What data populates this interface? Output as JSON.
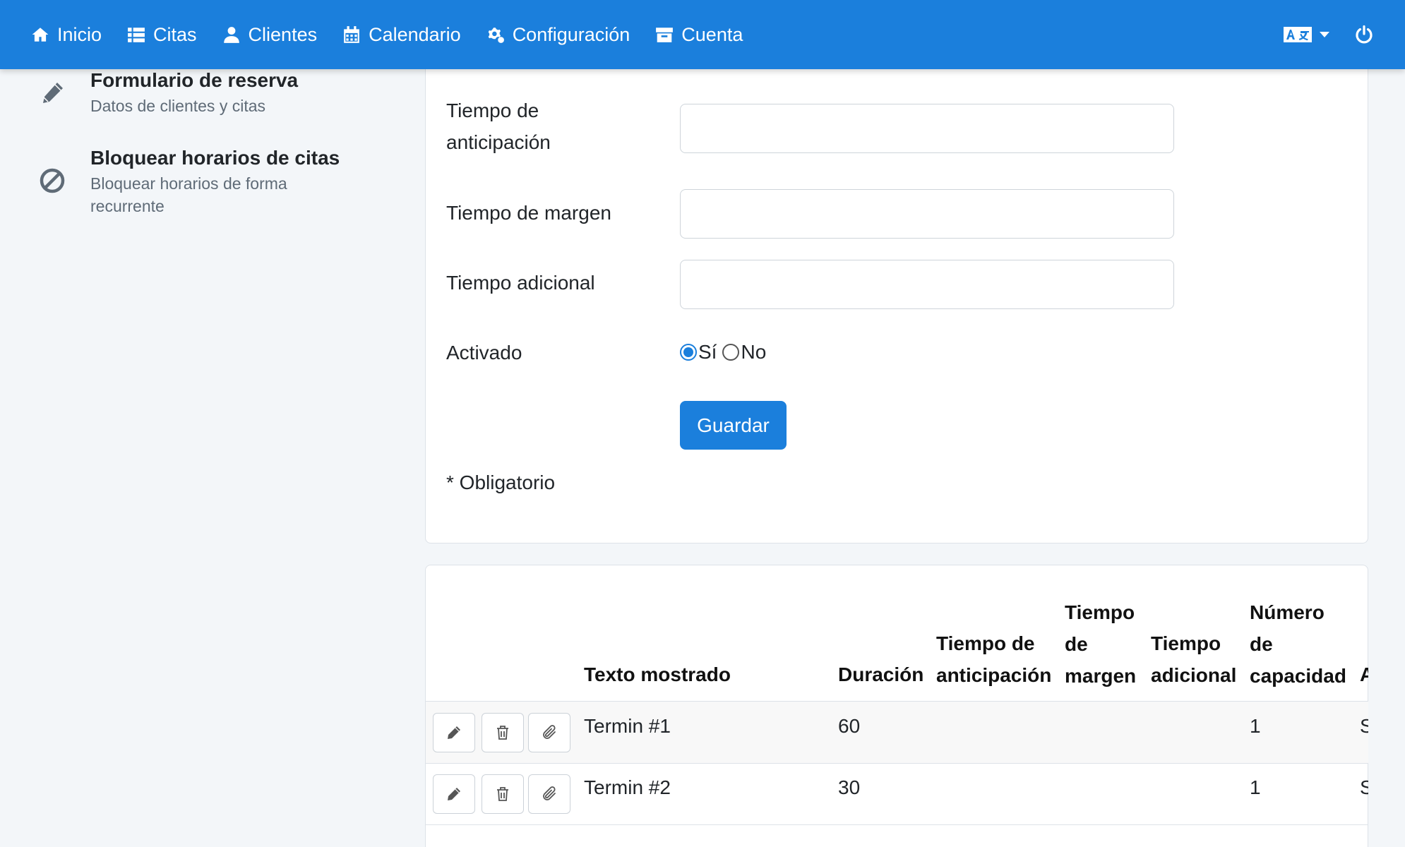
{
  "navbar": {
    "items": [
      {
        "label": "Inicio",
        "icon": "home-icon"
      },
      {
        "label": "Citas",
        "icon": "list-icon"
      },
      {
        "label": "Clientes",
        "icon": "user-icon"
      },
      {
        "label": "Calendario",
        "icon": "calendar-icon"
      },
      {
        "label": "Configuración",
        "icon": "cogs-icon"
      },
      {
        "label": "Cuenta",
        "icon": "archive-icon"
      }
    ],
    "language_icon": "language-icon",
    "power_icon": "power-icon",
    "bg_color": "#1b7fdc"
  },
  "sidebar": {
    "items": [
      {
        "title": "Formulario de reserva",
        "subtitle": "Datos de clientes y citas",
        "icon": "pencil-icon"
      },
      {
        "title": "Bloquear horarios de citas",
        "subtitle": "Bloquear horarios de forma recurrente",
        "icon": "ban-icon"
      }
    ]
  },
  "form": {
    "fields": [
      {
        "label": "Tiempo de anticipación",
        "value": ""
      },
      {
        "label": "Tiempo de margen",
        "value": ""
      },
      {
        "label": "Tiempo adicional",
        "value": ""
      }
    ],
    "activated": {
      "label": "Activado",
      "options": [
        {
          "label": "Sí",
          "checked": true
        },
        {
          "label": "No",
          "checked": false
        }
      ]
    },
    "save_label": "Guardar",
    "required_note": "* Obligatorio"
  },
  "table": {
    "headers": {
      "display_text": "Texto mostrado",
      "duration": "Duración",
      "lead_time": [
        "Tiempo de",
        "anticipación"
      ],
      "margin_time": [
        "Tiempo",
        "de",
        "margen"
      ],
      "additional_time": [
        "Tiempo",
        "adicional"
      ],
      "capacity": [
        "Número",
        "de",
        "capacidad"
      ],
      "cut_next": "A"
    },
    "rows": [
      {
        "display_text": "Termin #1",
        "duration": "60",
        "lead_time": "",
        "margin_time": "",
        "additional_time": "",
        "capacity": "1",
        "cut_next": "S"
      },
      {
        "display_text": "Termin #2",
        "duration": "30",
        "lead_time": "",
        "margin_time": "",
        "additional_time": "",
        "capacity": "1",
        "cut_next": "S"
      }
    ],
    "row_actions": [
      "edit-icon",
      "trash-icon",
      "paperclip-icon"
    ]
  }
}
